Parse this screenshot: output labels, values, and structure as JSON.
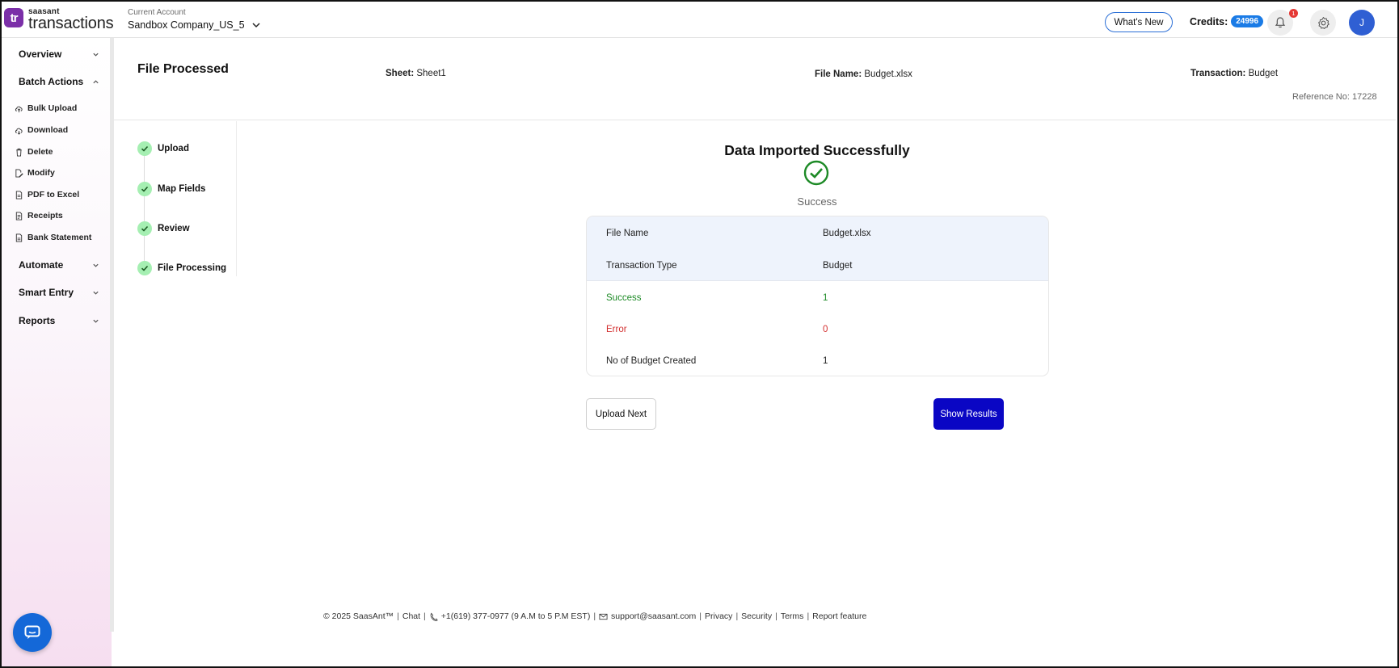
{
  "app": {
    "logo_mark": "tr",
    "logo_small": "saasant",
    "logo_big": "transactions",
    "account_label": "Current Account",
    "account_name": "Sandbox Company_US_5"
  },
  "header": {
    "whats_new": "What's New",
    "credits_label": "Credits:",
    "credits_value": "24996",
    "notification_count": "1",
    "avatar_initial": "J"
  },
  "sidebar": {
    "overview": "Overview",
    "batch_actions": "Batch Actions",
    "items": [
      "Bulk Upload",
      "Download",
      "Delete",
      "Modify",
      "PDF to Excel",
      "Receipts",
      "Bank Statement"
    ],
    "automate": "Automate",
    "smart_entry": "Smart Entry",
    "reports": "Reports"
  },
  "page": {
    "title": "File Processed",
    "sheet_label": "Sheet:",
    "sheet_value": "Sheet1",
    "file_label": "File Name:",
    "file_value": "Budget.xlsx",
    "transaction_label": "Transaction:",
    "transaction_value": "Budget",
    "reference": "Reference No: 17228"
  },
  "steps": [
    "Upload",
    "Map Fields",
    "Review",
    "File Processing"
  ],
  "result": {
    "title": "Data Imported Successfully",
    "status": "Success",
    "rows": [
      {
        "key": "File Name",
        "value": "Budget.xlsx"
      },
      {
        "key": "Transaction Type",
        "value": "Budget"
      },
      {
        "key": "Success",
        "value": "1"
      },
      {
        "key": "Error",
        "value": "0"
      },
      {
        "key": "No of Budget Created",
        "value": "1"
      }
    ],
    "upload_next": "Upload Next",
    "show_results": "Show Results"
  },
  "footer": {
    "copyright": "© 2025 SaasAnt™",
    "chat": "Chat",
    "phone": "+1(619) 377-0977 (9 A.M to 5 P.M EST)",
    "email": "support@saasant.com",
    "privacy": "Privacy",
    "security": "Security",
    "terms": "Terms",
    "report": "Report feature"
  },
  "colors": {
    "accent": "#0a06c4",
    "success": "#1d8a26",
    "error": "#d32f2f",
    "step_done": "#a5efb2"
  }
}
